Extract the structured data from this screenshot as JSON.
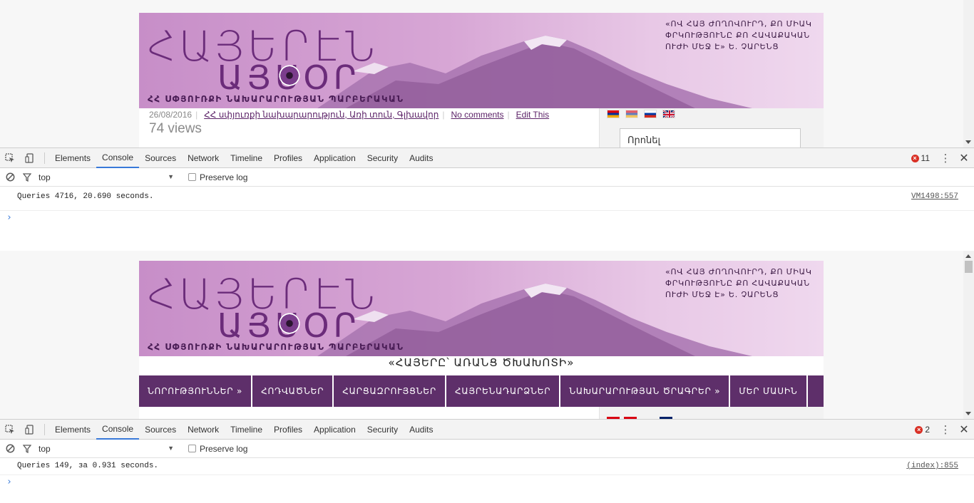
{
  "pane1": {
    "banner": {
      "logo_main": "ՀԱՅԵՐԷՆ",
      "logo_sub": "ԱՅՍՕՐ",
      "tagline": "ՀՀ ՍՓՅՈՒՌՔԻ ՆԱԽԱՐԱՐՈՒԹՅԱՆ ՊԱՐԲԵՐԱԿԱՆ",
      "quote": "«ՈՎ ՀԱՅ ԺՈՂՈՎՈՒՐԴ, ՔՈ ՄԻԱԿ ՓՐԿՈՒԹՅՈՒՆԸ ՔՈ ՀԱՎԱՔԱԿԱՆ ՈՒԺԻ ՄԵՋ Է»   Ե. ՉԱՐԵՆՑ"
    },
    "post_meta": {
      "date": "26/08/2016",
      "categories": "ՀՀ սփյուռքի նախարարություն, Առի տուն, Գլխավոր",
      "comments": "No comments",
      "edit": "Edit This",
      "views": "74 views"
    },
    "sidebar": {
      "search_placeholder": "Որոնել"
    }
  },
  "devtools1": {
    "tabs": [
      "Elements",
      "Console",
      "Sources",
      "Network",
      "Timeline",
      "Profiles",
      "Application",
      "Security",
      "Audits"
    ],
    "active_tab": "Console",
    "error_count": "11",
    "context": "top",
    "preserve_log": "Preserve log",
    "log_message": "Queries 4716, 20.690 seconds.",
    "log_source": "VM1498:557",
    "prompt": "›"
  },
  "pane2": {
    "banner": {
      "logo_main": "ՀԱՅԵՐԷՆ",
      "logo_sub": "ԱՅՍՕՐ",
      "tagline": "ՀՀ ՍՓՅՈՒՌՔԻ ՆԱԽԱՐԱՐՈՒԹՅԱՆ ՊԱՐԲԵՐԱԿԱՆ",
      "quote": "«ՈՎ ՀԱՅ ԺՈՂՈՎՈՒՐԴ, ՔՈ ՄԻԱԿ ՓՐԿՈՒԹՅՈՒՆԸ ՔՈ ՀԱՎԱՔԱԿԱՆ ՈՒԺԻ ՄԵՋ Է»   Ե. ՉԱՐԵՆՑ"
    },
    "motto": "«ՀԱՅԵՐԸ՝ ԱՌԱՆՑ ԾԽԱԽՈՏԻ»",
    "nav": [
      "ՆՈՐՈՒԹՅՈՒՆՆԵՐ »",
      "ՀՈԴՎԱԾՆԵՐ",
      "ՀԱՐՑԱԶՐՈՒՅՑՆԵՐ",
      "ՀԱՅՐԵՆԱԴԱՐՁՆԵՐ",
      "ՆԱԽԱՐԱՐՈՒԹՅԱՆ ԾՐԱԳՐԵՐ »",
      "ՄԵՐ ՄԱՍԻՆ"
    ]
  },
  "devtools2": {
    "tabs": [
      "Elements",
      "Console",
      "Sources",
      "Network",
      "Timeline",
      "Profiles",
      "Application",
      "Security",
      "Audits"
    ],
    "active_tab": "Console",
    "error_count": "2",
    "context": "top",
    "preserve_log": "Preserve log",
    "log_message": "Queries 149, за 0.931 seconds.",
    "log_source": "(index):855",
    "prompt": "›"
  },
  "colors": {
    "banner_purple": "#c78ec8",
    "nav_purple": "#5e2f6a",
    "devtools_accent": "#3879d9",
    "error_red": "#d93025"
  },
  "icons": [
    "inspect-icon",
    "device-icon",
    "clear-console-icon",
    "filter-icon",
    "error-icon",
    "kebab-menu-icon",
    "close-icon",
    "flag-am-icon",
    "flag-ru-icon",
    "flag-gb-icon"
  ]
}
